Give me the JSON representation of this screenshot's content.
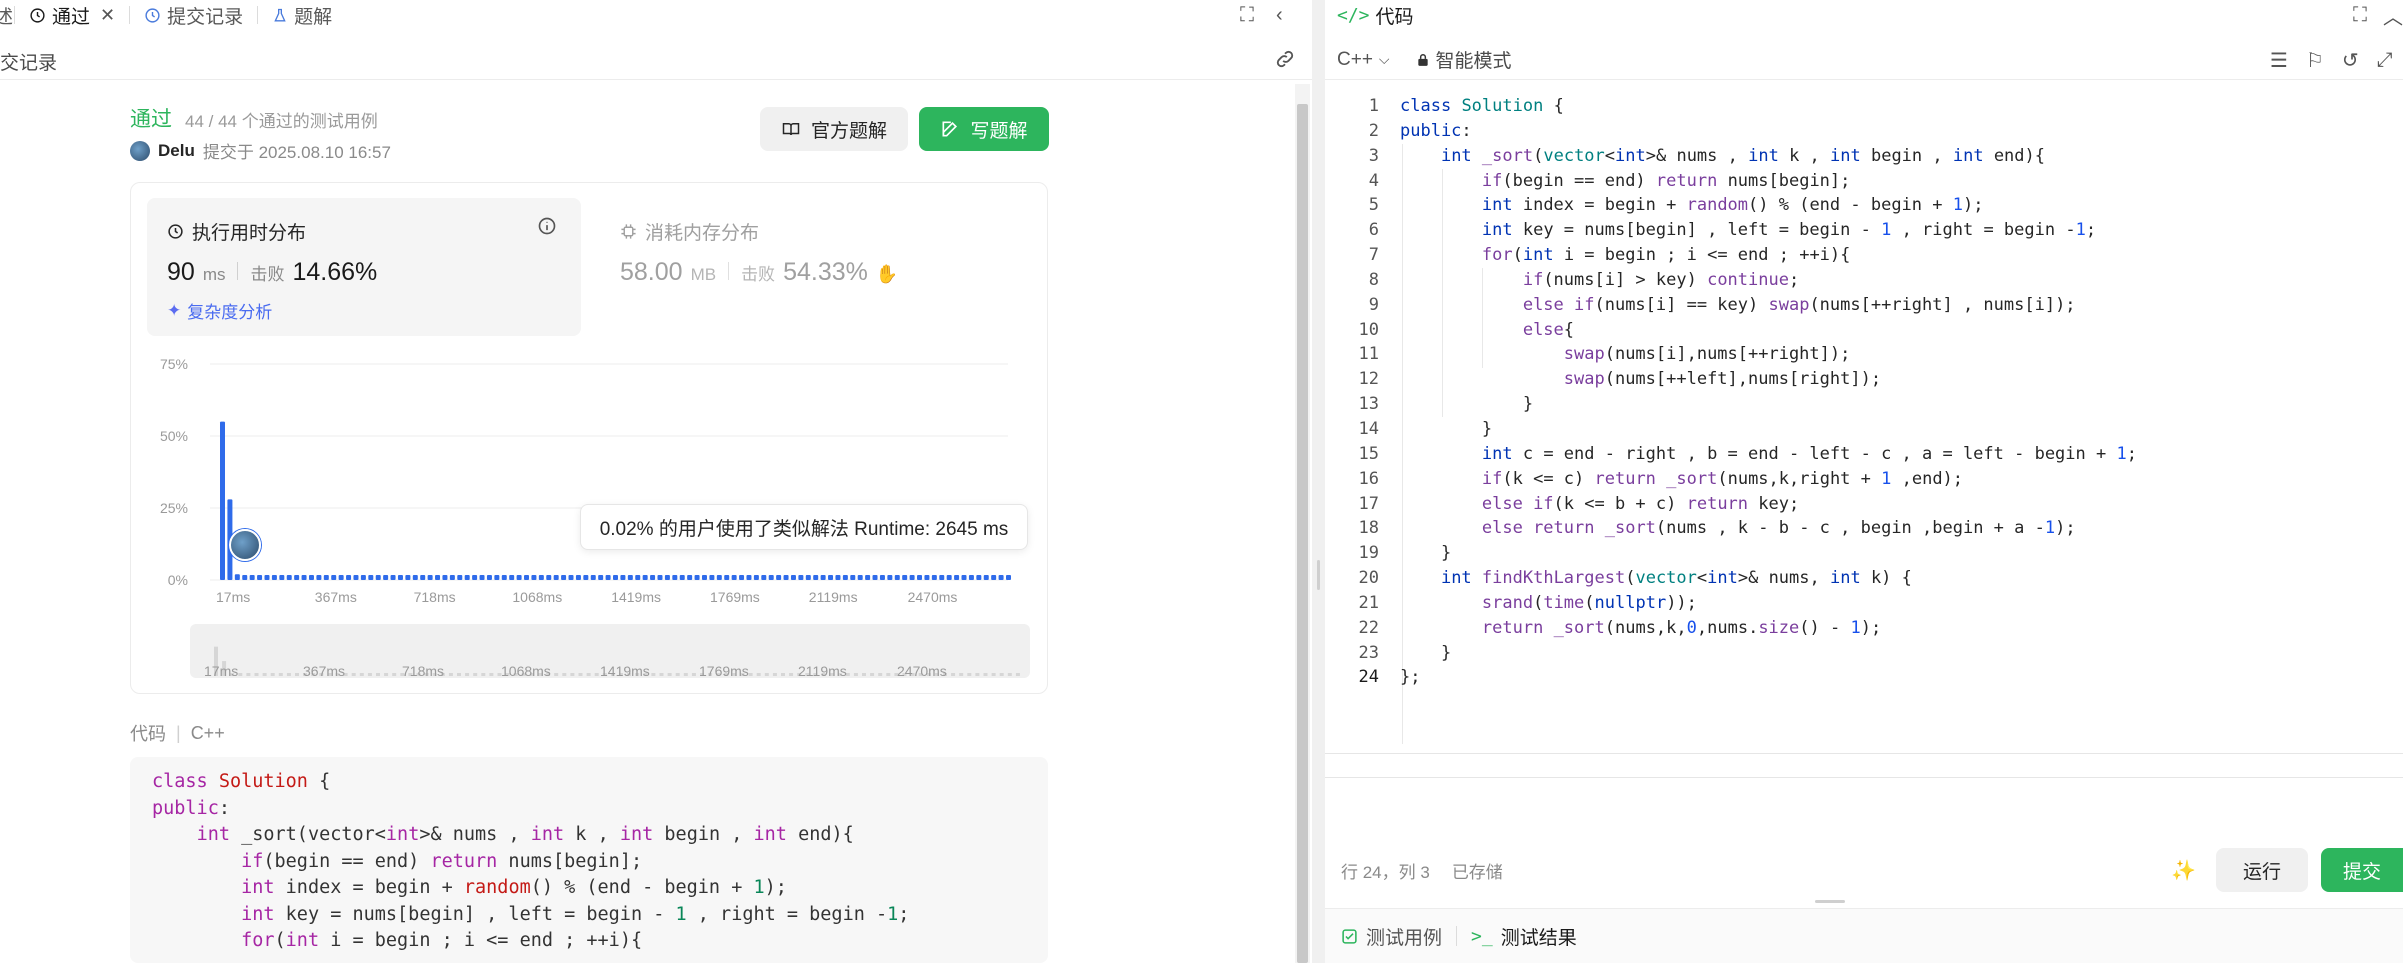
{
  "left_tabs": {
    "first_partial": "述",
    "pass_tab": "通过",
    "submissions_tab": "提交记录",
    "solutions_tab": "题解"
  },
  "left_sub": {
    "title_partial": "交记录"
  },
  "result": {
    "status": "通过",
    "tests": "44 / 44 个通过的测试用例",
    "author": "Delu",
    "submitted": "提交于 2025.08.10 16:57",
    "official_btn": "官方题解",
    "write_btn": "写题解"
  },
  "runtime": {
    "title": "执行用时分布",
    "value": "90",
    "unit": "ms",
    "beats_label": "击败",
    "beats": "14.66%",
    "complexity": "复杂度分析"
  },
  "memory": {
    "title": "消耗内存分布",
    "value": "58.00",
    "unit": "MB",
    "beats_label": "击败",
    "beats": "54.33%"
  },
  "tooltip": "0.02% 的用户使用了类似解法 Runtime: 2645 ms",
  "chart_data": {
    "type": "bar",
    "y_ticks": [
      "75%",
      "50%",
      "25%",
      "0%"
    ],
    "ylim": [
      0,
      75
    ],
    "x_ticks": [
      "17ms",
      "367ms",
      "718ms",
      "1068ms",
      "1419ms",
      "1769ms",
      "2119ms",
      "2470ms"
    ],
    "bars": [
      55,
      28,
      2,
      1,
      1
    ],
    "legend_position": "none",
    "grid": true
  },
  "code_section": {
    "label": "代码",
    "lang": "C++"
  },
  "right_tabs": {
    "code_tab": "代码"
  },
  "right_toolbar": {
    "lang": "C++",
    "mode": "智能模式"
  },
  "editor_status": {
    "pos": "行 24，列 3",
    "saved": "已存储"
  },
  "buttons": {
    "run": "运行",
    "submit": "提交"
  },
  "bottom_tabs": {
    "testcase": "测试用例",
    "result": "测试结果"
  },
  "line_numbers": [
    "1",
    "2",
    "3",
    "4",
    "5",
    "6",
    "7",
    "8",
    "9",
    "10",
    "11",
    "12",
    "13",
    "14",
    "15",
    "16",
    "17",
    "18",
    "19",
    "20",
    "21",
    "22",
    "23",
    "24"
  ]
}
